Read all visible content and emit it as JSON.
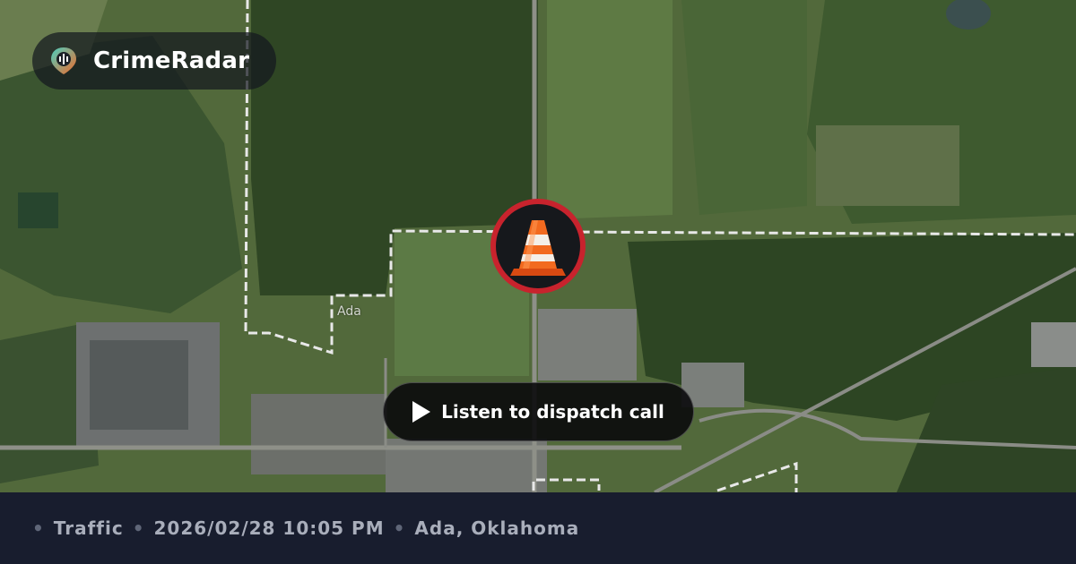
{
  "brand": {
    "name": "CrimeRadar",
    "logo_icon": "radar-pin-icon"
  },
  "map": {
    "town_label": "Ada"
  },
  "incident": {
    "icon": "traffic-cone-icon",
    "ring_color": "#c8232d",
    "listen_label": "Listen to dispatch call"
  },
  "footer": {
    "separator": "•",
    "category": "Traffic",
    "datetime": "2026/02/28 10:05 PM",
    "location": "Ada, Oklahoma"
  }
}
